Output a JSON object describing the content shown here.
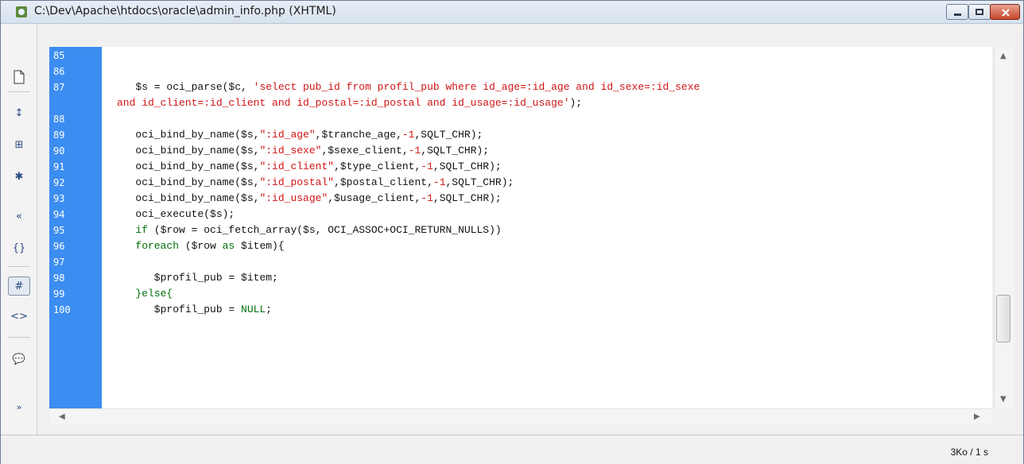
{
  "window": {
    "title": "C:\\Dev\\Apache\\htdocs\\oracle\\admin_info.php (XHTML)"
  },
  "toolbar": {
    "icons": [
      "new-doc-icon",
      "collapse-icon",
      "expand-icon",
      "collapse-all-icon",
      "select-tag-icon",
      "braces-icon",
      "line-numbers-icon",
      "validate-icon",
      "comment-icon",
      "more-icon"
    ]
  },
  "editor": {
    "lines": [
      {
        "n": "85",
        "text": ""
      },
      {
        "n": "86",
        "text": ""
      },
      {
        "n": "87",
        "text": "   $s = oci_parse($c, 'select pub_id from profil_pub where id_age=:id_age and id_sexe=:id_sexe"
      },
      {
        "n": "",
        "text": "and id_client=:id_client and id_postal=:id_postal and id_usage=:id_usage');"
      },
      {
        "n": "88",
        "text": ""
      },
      {
        "n": "89",
        "text": "   oci_bind_by_name($s,\":id_age\",$tranche_age,-1,SQLT_CHR);"
      },
      {
        "n": "90",
        "text": "   oci_bind_by_name($s,\":id_sexe\",$sexe_client,-1,SQLT_CHR);"
      },
      {
        "n": "91",
        "text": "   oci_bind_by_name($s,\":id_client\",$type_client,-1,SQLT_CHR);"
      },
      {
        "n": "92",
        "text": "   oci_bind_by_name($s,\":id_postal\",$postal_client,-1,SQLT_CHR);"
      },
      {
        "n": "93",
        "text": "   oci_bind_by_name($s,\":id_usage\",$usage_client,-1,SQLT_CHR);"
      },
      {
        "n": "94",
        "text": "   oci_execute($s);"
      },
      {
        "n": "95",
        "text": "   if ($row = oci_fetch_array($s, OCI_ASSOC+OCI_RETURN_NULLS))"
      },
      {
        "n": "96",
        "text": "   foreach ($row as $item){"
      },
      {
        "n": "97",
        "text": ""
      },
      {
        "n": "98",
        "text": "      $profil_pub = $item;"
      },
      {
        "n": "99",
        "text": "   }else{"
      },
      {
        "n": "100",
        "text": "      $profil_pub = NULL;"
      }
    ]
  },
  "status": {
    "text": "3Ko / 1 s"
  },
  "colors": {
    "gutter": "#3c8df1",
    "string": "#d01414",
    "keyword": "#00700b"
  }
}
